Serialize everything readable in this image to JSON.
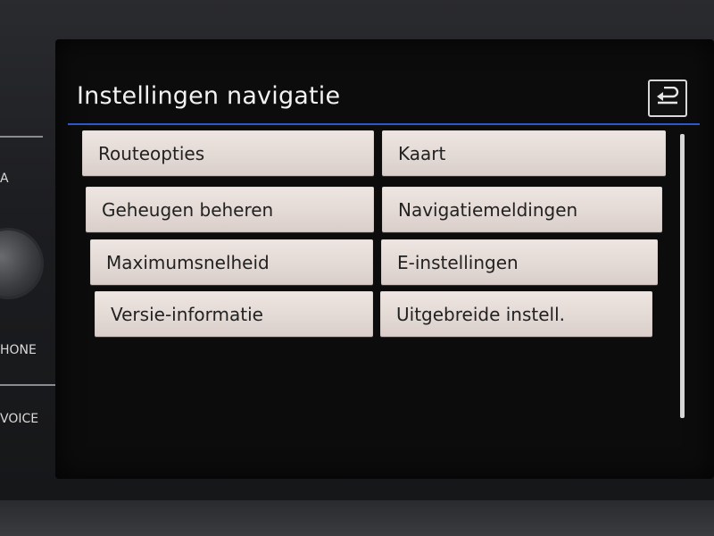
{
  "header": {
    "title": "Instellingen navigatie"
  },
  "side_panel": {
    "label_a": "A",
    "label_phone": "HONE",
    "label_voice": "VOICE"
  },
  "menu": {
    "items": [
      {
        "label": "Routeopties"
      },
      {
        "label": "Kaart"
      },
      {
        "label": "Geheugen beheren"
      },
      {
        "label": "Navigatiemeldingen"
      },
      {
        "label": "Maximumsnelheid"
      },
      {
        "label": "E-instellingen"
      },
      {
        "label": "Versie-informatie"
      },
      {
        "label": "Uitgebreide instell."
      }
    ]
  },
  "icons": {
    "back": "back-arrow-icon"
  },
  "colors": {
    "accent": "#2f57c8",
    "button_bg": "#e6ddd9",
    "title_text": "#f2f2f2"
  }
}
